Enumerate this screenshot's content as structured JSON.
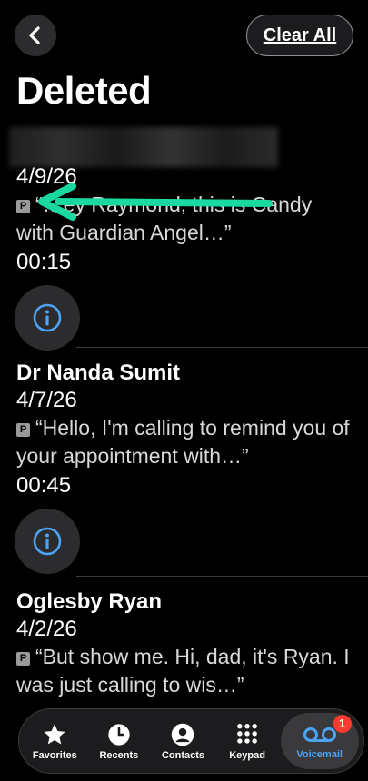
{
  "header": {
    "title": "Deleted",
    "clear_all_label": "Clear All"
  },
  "voicemails": [
    {
      "caller": "",
      "date": "4/9/26",
      "transcript": "“…ey Raymond, this is Candy with Guardian Angel…”",
      "duration": "00:15"
    },
    {
      "caller": "Dr Nanda Sumit",
      "date": "4/7/26",
      "transcript": "“Hello, I'm calling to remind you of your appointment with…”",
      "duration": "00:45"
    },
    {
      "caller": "Oglesby Ryan",
      "date": "4/2/26",
      "transcript": "“But show me.  Hi, dad, it's Ryan.  I was just calling to wis…”",
      "duration": ""
    }
  ],
  "tabbar": {
    "items": [
      {
        "label": "Favorites",
        "icon": "star-icon"
      },
      {
        "label": "Recents",
        "icon": "clock-icon"
      },
      {
        "label": "Contacts",
        "icon": "person-icon"
      },
      {
        "label": "Keypad",
        "icon": "keypad-icon"
      },
      {
        "label": "Voicemail",
        "icon": "voicemail-icon",
        "badge": "1",
        "active": true
      }
    ]
  },
  "colors": {
    "accent": "#4ba4f8",
    "badge": "#ff3b30",
    "annotation_arrow": "#19d8a0"
  }
}
